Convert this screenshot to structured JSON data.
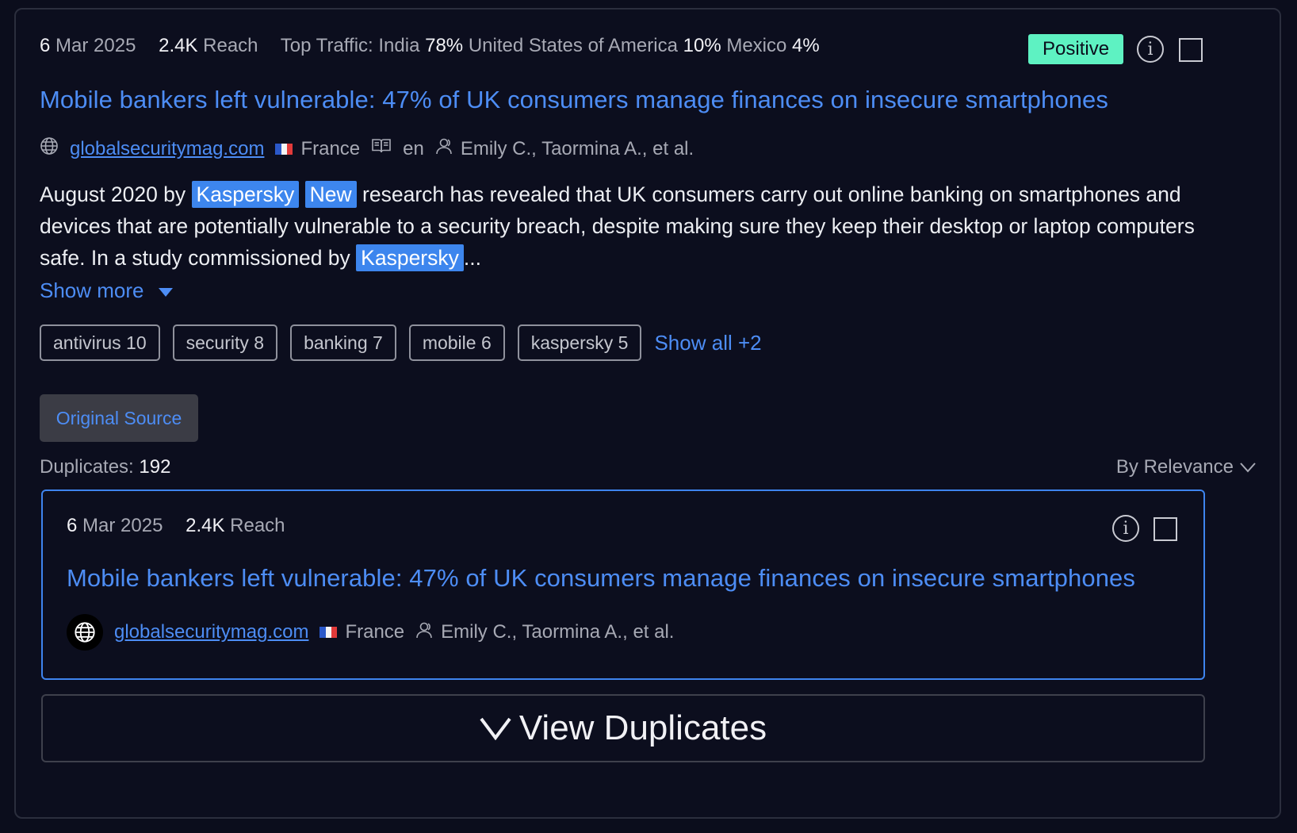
{
  "article": {
    "date_day": "6",
    "date_rest": "Mar 2025",
    "reach_value": "2.4K",
    "reach_label": "Reach",
    "traffic_label": "Top Traffic:",
    "traffic": [
      {
        "country": "India",
        "pct": "78%"
      },
      {
        "country": "United States of America",
        "pct": "10%"
      },
      {
        "country": "Mexico",
        "pct": "4%"
      }
    ],
    "sentiment": "Positive",
    "title": "Mobile bankers left vulnerable: 47% of UK consumers manage finances on insecure smartphones",
    "source": "globalsecuritymag.com",
    "country": "France",
    "language": "en",
    "authors": "Emily C., Taormina A., et al.",
    "body": {
      "part1": "August 2020 by",
      "hl1": "Kaspersky",
      "hl2": "New",
      "part2": "research has revealed that UK consumers carry out online banking on smartphones and devices that are potentially vulnerable to a security breach, despite making sure they keep their desktop or laptop computers safe. In a study commissioned by",
      "hl3": "Kaspersky",
      "ellipsis": "..."
    },
    "show_more": "Show more",
    "tags": [
      "antivirus 10",
      "security 8",
      "banking 7",
      "mobile 6",
      "kaspersky 5"
    ],
    "show_all": "Show all +2",
    "original_source": "Original Source",
    "duplicates_label": "Duplicates:",
    "duplicates_count": "192",
    "sort_label": "By Relevance"
  },
  "duplicate": {
    "date_day": "6",
    "date_rest": "Mar 2025",
    "reach_value": "2.4K",
    "reach_label": "Reach",
    "title": "Mobile bankers left vulnerable: 47% of UK consumers manage finances on insecure smartphones",
    "source": "globalsecuritymag.com",
    "country": "France",
    "authors": "Emily C., Taormina A., et al."
  },
  "view_duplicates": "View Duplicates",
  "colors": {
    "background": "#0b0d1c",
    "link": "#4d8df5",
    "highlight": "#3d86ee",
    "positive": "#5ef2c2",
    "border_active": "#3e84ee"
  }
}
